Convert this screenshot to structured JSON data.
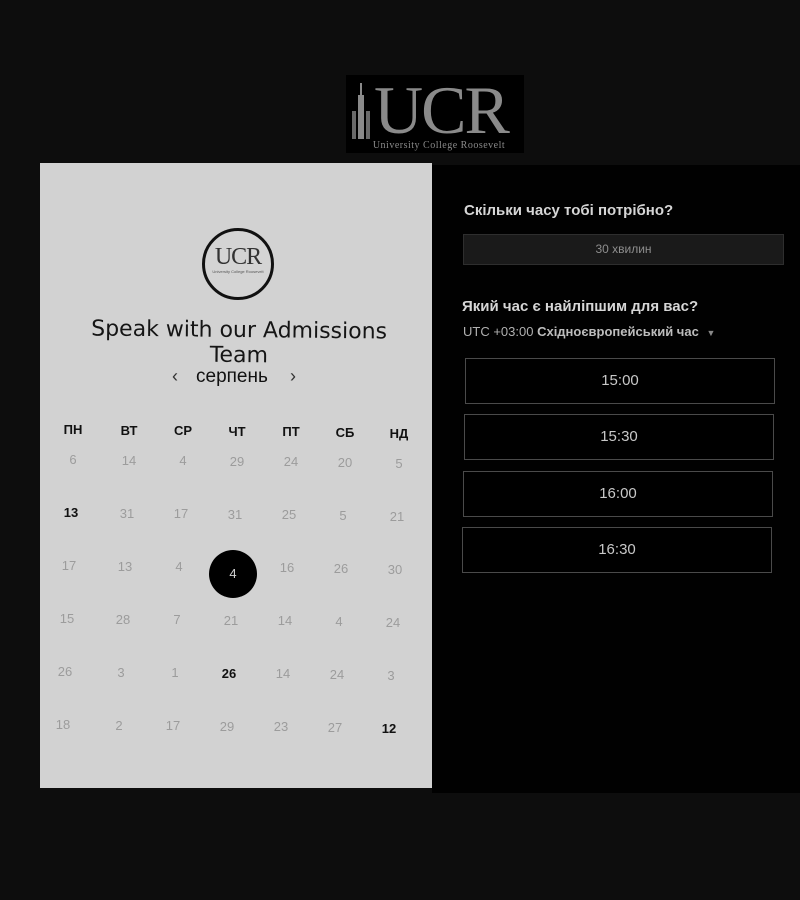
{
  "brand": {
    "logo_text": "UCR",
    "logo_subtitle": "University College Roosevelt",
    "circle_logo_text": "UCR",
    "circle_logo_subtitle": "University College Roosevelt"
  },
  "left": {
    "heading": "Speak with our Admissions Team",
    "month": "серпень",
    "prev_icon": "chevron-left-icon",
    "next_icon": "chevron-right-icon",
    "weekdays": [
      "ПН",
      "ВТ",
      "СР",
      "ЧТ",
      "ПТ",
      "СБ",
      "НД"
    ],
    "weeks": [
      [
        "6",
        "14",
        "4",
        "29",
        "24",
        "20",
        "5"
      ],
      [
        "13",
        "31",
        "17",
        "31",
        "25",
        "5",
        "21"
      ],
      [
        "17",
        "13",
        "4",
        "4",
        "16",
        "26",
        "30"
      ],
      [
        "15",
        "28",
        "7",
        "21",
        "14",
        "4",
        "24"
      ],
      [
        "26",
        "3",
        "1",
        "26",
        "14",
        "24",
        "3"
      ],
      [
        "18",
        "2",
        "17",
        "29",
        "23",
        "27",
        "12"
      ]
    ],
    "available_days": [
      "13",
      "26",
      "12"
    ],
    "selected_day": "4"
  },
  "right": {
    "duration_question": "Скільки часу тобі потрібно?",
    "duration_value": "30 хвилин",
    "time_question": "Який час є найліпшим для вас?",
    "timezone_offset": "UTC +03:00",
    "timezone_name": "Східноєвропейський час",
    "timezone_icon": "caret-down-icon",
    "slots": [
      "15:00",
      "15:30",
      "16:00",
      "16:30"
    ]
  },
  "colors": {
    "background": "#0d0d0d",
    "left_panel": "#d2d2d2",
    "right_panel": "#010101",
    "selected_day": "#000000"
  }
}
